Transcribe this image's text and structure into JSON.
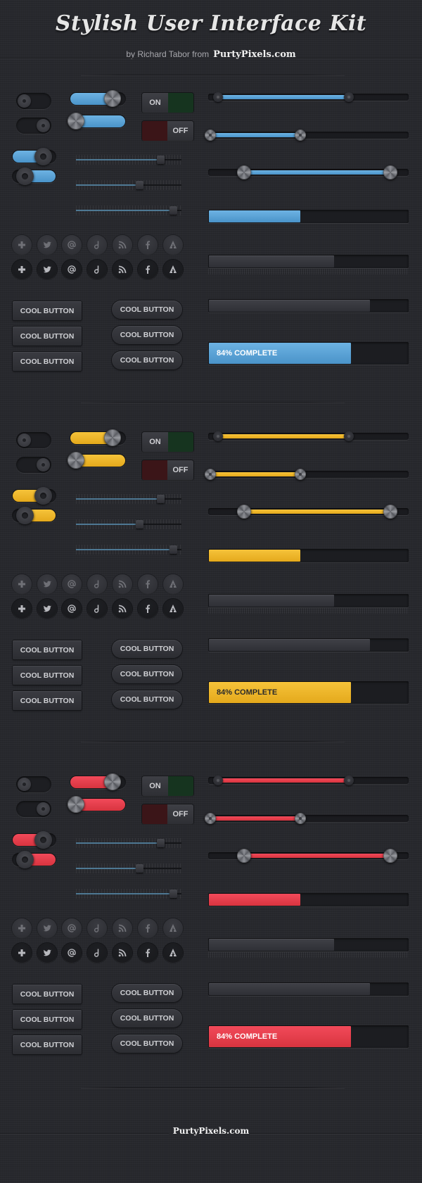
{
  "header": {
    "title": "Stylish User Interface Kit",
    "byline": "by Richard Tabor from",
    "brand": "PurtyPixels.com"
  },
  "footer": {
    "brand": "PurtyPixels.com"
  },
  "shared": {
    "on_label": "ON",
    "off_label": "OFF",
    "square_buttons": [
      "COOL BUTTON",
      "COOL BUTTON",
      "COOL BUTTON"
    ],
    "pill_buttons": [
      "COOL BUTTON",
      "COOL BUTTON",
      "COOL BUTTON"
    ],
    "icons": [
      "plus-icon",
      "twitter-icon",
      "at-icon",
      "delicious-icon",
      "rss-icon",
      "facebook-icon",
      "forrst-icon"
    ],
    "on_color": "#16341f",
    "off_color": "#3b1518",
    "tick_sliders": [
      0.8,
      0.6,
      0.92
    ],
    "range_sliders": [
      {
        "low": 0.05,
        "high": 0.7,
        "handle": "dark"
      },
      {
        "low": 0.01,
        "high": 0.46,
        "handle": "bolt"
      },
      {
        "low": 0.18,
        "high": 0.91,
        "handle": "metal"
      }
    ],
    "progress": [
      0.46,
      0.63,
      0.81
    ],
    "big_progress": {
      "value": 0.84,
      "label": "84% COMPLETE"
    },
    "small_toggles": [
      "off",
      "on"
    ],
    "color_toggles": [
      "on",
      "off"
    ],
    "pill_toggles": [
      0.75,
      0.1
    ]
  },
  "themes": [
    {
      "name": "blue",
      "accent": "#6db3e3",
      "accent_dark": "#4a93c9",
      "label_color": "#ffffff"
    },
    {
      "name": "yellow",
      "accent": "#f6c33a",
      "accent_dark": "#e4a91c",
      "label_color": "#2a2a2a"
    },
    {
      "name": "red",
      "accent": "#f24a5a",
      "accent_dark": "#d8343f",
      "label_color": "#ffffff"
    }
  ]
}
